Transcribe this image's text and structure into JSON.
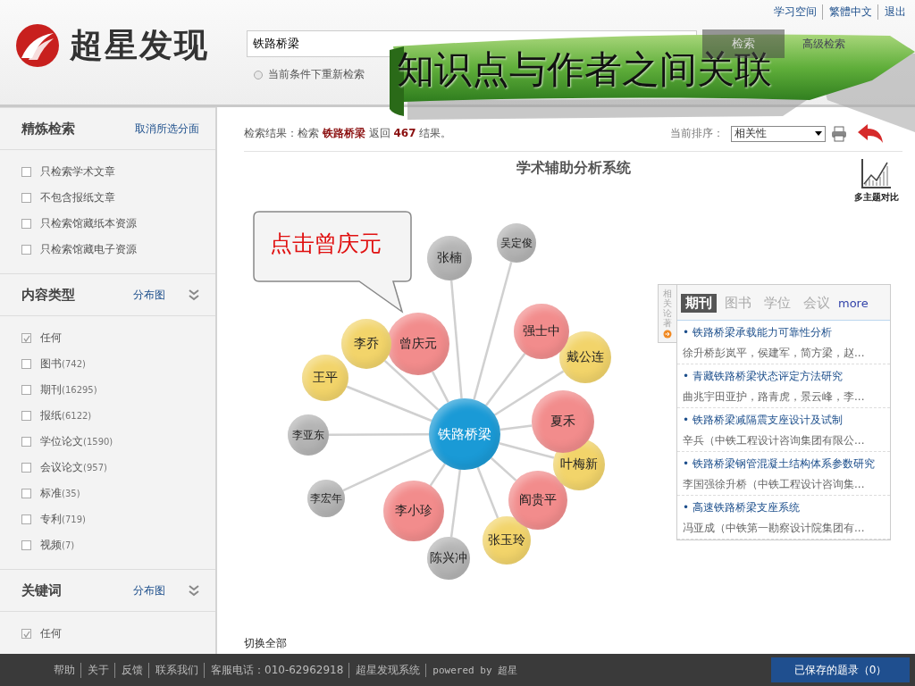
{
  "header": {
    "logo_text": "超星发现",
    "top_links": [
      "学习空间",
      "繁體中文",
      "退出"
    ],
    "search": {
      "value": "铁路桥梁"
    },
    "search_button": "检索",
    "advanced_link": "高级检索",
    "radio": {
      "label": "当前条件下重新检索",
      "selected": false
    }
  },
  "banner": {
    "text": "知识点与作者之间关联"
  },
  "sidebar": {
    "sections": [
      {
        "title": "精炼检索",
        "link": "取消所选分面",
        "expandable": false,
        "items": [
          {
            "label": "只检索学术文章",
            "checked": false
          },
          {
            "label": "不包含报纸文章",
            "checked": false
          },
          {
            "label": "只检索馆藏纸本资源",
            "checked": false
          },
          {
            "label": "只检索馆藏电子资源",
            "checked": false
          }
        ]
      },
      {
        "title": "内容类型",
        "link": "分布图",
        "expandable": true,
        "items": [
          {
            "label": "任何",
            "checked": true
          },
          {
            "label": "图书",
            "count": "(742)",
            "checked": false
          },
          {
            "label": "期刊",
            "count": "(16295)",
            "checked": false
          },
          {
            "label": "报纸",
            "count": "(6122)",
            "checked": false
          },
          {
            "label": "学位论文",
            "count": "(1590)",
            "checked": false
          },
          {
            "label": "会议论文",
            "count": "(957)",
            "checked": false
          },
          {
            "label": "标准",
            "count": "(35)",
            "checked": false
          },
          {
            "label": "专利",
            "count": "(719)",
            "checked": false
          },
          {
            "label": "视频",
            "count": "(7)",
            "checked": false
          }
        ]
      },
      {
        "title": "关键词",
        "link": "分布图",
        "expandable": true,
        "items": [
          {
            "label": "任何",
            "checked": true
          }
        ]
      }
    ]
  },
  "results": {
    "summary": "检索结果：检索 **铁路桥梁** 返回 **467** 结果。",
    "sort_label": "当前排序：",
    "sort_value": "相关性"
  },
  "analysis": {
    "title": "学术辅助分析系统",
    "compare_label": "多主题对比",
    "callout": "点击曾庆元",
    "switch_all": "切换全部",
    "center": {
      "name": "铁路桥梁",
      "color": "#1a9ad6"
    },
    "nodes": [
      {
        "name": "张楠",
        "color": "#b4b4b4"
      },
      {
        "name": "吴定俊",
        "color": "#b4b4b4"
      },
      {
        "name": "曾庆元",
        "color": "#f28c8c"
      },
      {
        "name": "李乔",
        "color": "#f2d46a"
      },
      {
        "name": "王平",
        "color": "#f2d46a"
      },
      {
        "name": "李亚东",
        "color": "#b4b4b4"
      },
      {
        "name": "李宏年",
        "color": "#b4b4b4"
      },
      {
        "name": "李小珍",
        "color": "#f28c8c"
      },
      {
        "name": "陈兴冲",
        "color": "#b4b4b4"
      },
      {
        "name": "张玉玲",
        "color": "#f2d46a"
      },
      {
        "name": "阎贵平",
        "color": "#f28c8c"
      },
      {
        "name": "叶梅新",
        "color": "#f2d46a"
      },
      {
        "name": "夏禾",
        "color": "#f28c8c"
      },
      {
        "name": "戴公连",
        "color": "#f2d46a"
      },
      {
        "name": "强士中",
        "color": "#f28c8c"
      }
    ]
  },
  "related": {
    "side_tab": "相关论著",
    "tabs": [
      {
        "label": "期刊",
        "selected": true
      },
      {
        "label": "图书",
        "selected": false
      },
      {
        "label": "学位",
        "selected": false
      },
      {
        "label": "会议",
        "selected": false
      }
    ],
    "more": "more",
    "items": [
      {
        "title": "• 铁路桥梁承载能力可靠性分析",
        "authors": "徐升桥彭岚平，侯建军，简方梁，赵..."
      },
      {
        "title": "• 青藏铁路桥梁状态评定方法研究",
        "authors": "曲兆宇田亚护，路青虎，景云峰，李..."
      },
      {
        "title": "• 铁路桥梁减隔震支座设计及试制",
        "authors": "辛兵（中铁工程设计咨询集团有限公..."
      },
      {
        "title": "• 铁路桥梁钢管混凝土结构体系参数研究",
        "authors": "李国强徐升桥（中铁工程设计咨询集..."
      },
      {
        "title": "• 高速铁路桥梁支座系统",
        "authors": "冯亚成（中铁第一勘察设计院集团有..."
      }
    ]
  },
  "footer": {
    "links": [
      "帮助",
      "关于",
      "反馈",
      "联系我们",
      "客服电话：010-62962918",
      "超星发现系统",
      "powered by 超星"
    ],
    "saved_button": "已保存的题录（0）"
  }
}
